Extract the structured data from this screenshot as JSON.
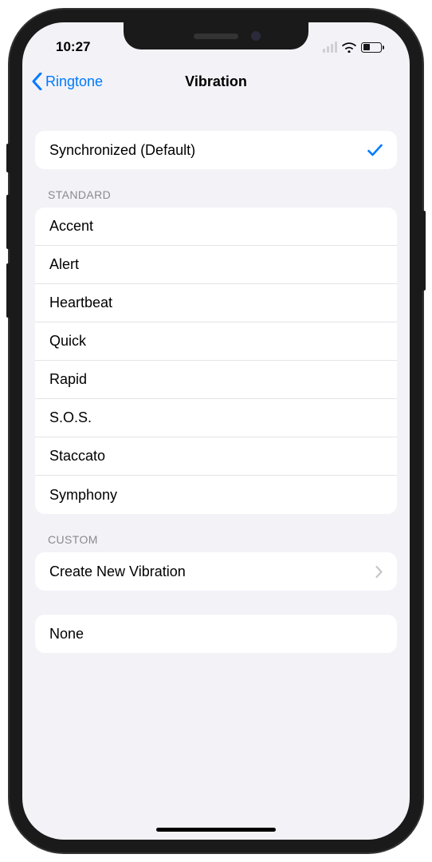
{
  "status": {
    "time": "10:27"
  },
  "nav": {
    "back_label": "Ringtone",
    "title": "Vibration"
  },
  "default_section": {
    "selected_label": "Synchronized (Default)"
  },
  "standard_section": {
    "header": "STANDARD",
    "items": [
      "Accent",
      "Alert",
      "Heartbeat",
      "Quick",
      "Rapid",
      "S.O.S.",
      "Staccato",
      "Symphony"
    ]
  },
  "custom_section": {
    "header": "CUSTOM",
    "create_label": "Create New Vibration"
  },
  "none_section": {
    "label": "None"
  }
}
